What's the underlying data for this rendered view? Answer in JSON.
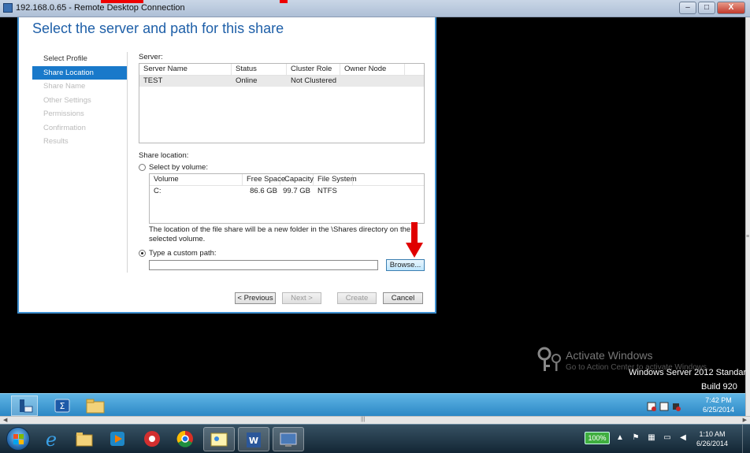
{
  "rdp": {
    "title": "192.168.0.65 - Remote Desktop Connection",
    "minimize": "–",
    "maximize": "□",
    "close": "X"
  },
  "wizard": {
    "title": "Select the server and path for this share",
    "nav": [
      {
        "label": "Select Profile",
        "state": "done"
      },
      {
        "label": "Share Location",
        "state": "active"
      },
      {
        "label": "Share Name",
        "state": "disabled"
      },
      {
        "label": "Other Settings",
        "state": "disabled"
      },
      {
        "label": "Permissions",
        "state": "disabled"
      },
      {
        "label": "Confirmation",
        "state": "disabled"
      },
      {
        "label": "Results",
        "state": "disabled"
      }
    ],
    "server_label": "Server:",
    "server_table": {
      "columns": [
        "Server Name",
        "Status",
        "Cluster Role",
        "Owner Node"
      ],
      "rows": [
        [
          "TEST",
          "Online",
          "Not Clustered",
          ""
        ]
      ]
    },
    "share_location_label": "Share location:",
    "select_by_volume_label": "Select by volume:",
    "volume_table": {
      "columns": [
        "Volume",
        "Free Space",
        "Capacity",
        "File System"
      ],
      "rows": [
        [
          "C:",
          "86.6 GB",
          "99.7 GB",
          "NTFS"
        ]
      ]
    },
    "volume_note": "The location of the file share will be a new folder in the \\Shares directory on the selected volume.",
    "custom_path_label": "Type a custom path:",
    "custom_path_value": "",
    "browse_label": "Browse...",
    "previous_label": "< Previous",
    "next_label": "Next >",
    "create_label": "Create",
    "cancel_label": "Cancel",
    "selected_option": "custom_path"
  },
  "watermark": {
    "line1": "Activate Windows",
    "line2": "Go to Action Center to activate Windows.",
    "line3": "Windows Server 2012 Standar",
    "line4": "Build 920"
  },
  "remote_taskbar": {
    "time": "7:42 PM",
    "date": "6/25/2014"
  },
  "local_taskbar": {
    "battery": "100%",
    "time": "1:10 AM",
    "date": "6/26/2014"
  },
  "colors": {
    "accent": "#1979ca",
    "title_blue": "#1e5fa8",
    "arrow_red": "#e00000",
    "remote_taskbar": "#3a99d4"
  }
}
